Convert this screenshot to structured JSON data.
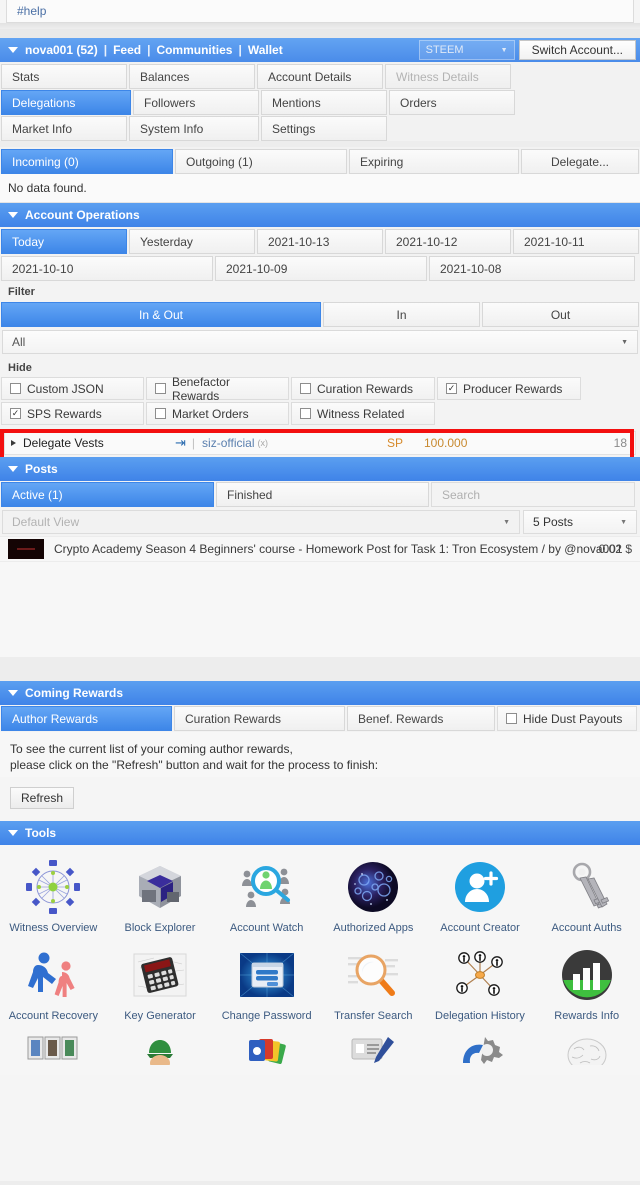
{
  "help_strip": {
    "tag": "#help"
  },
  "account_bar": {
    "username": "nova001 (52)",
    "links": [
      "Feed",
      "Communities",
      "Wallet"
    ],
    "coin": "STEEM",
    "switch_label": "Switch Account..."
  },
  "nav_tabs": [
    {
      "label": "Stats",
      "state": "normal"
    },
    {
      "label": "Balances",
      "state": "normal"
    },
    {
      "label": "Account Details",
      "state": "normal"
    },
    {
      "label": "Witness Details",
      "state": "disabled"
    },
    {
      "label": "Delegations",
      "state": "selected"
    },
    {
      "label": "Followers",
      "state": "normal"
    },
    {
      "label": "Mentions",
      "state": "normal"
    },
    {
      "label": "Orders",
      "state": "normal"
    },
    {
      "label": "Market Info",
      "state": "normal"
    },
    {
      "label": "System Info",
      "state": "normal"
    },
    {
      "label": "Settings",
      "state": "normal"
    }
  ],
  "delegations": {
    "tabs": [
      {
        "label": "Incoming (0)",
        "state": "selected"
      },
      {
        "label": "Outgoing (1)",
        "state": "normal"
      },
      {
        "label": "Expiring",
        "state": "normal"
      },
      {
        "label": "Delegate...",
        "state": "normal"
      }
    ],
    "empty_message": "No data found."
  },
  "account_operations": {
    "title": "Account Operations",
    "date_tabs": [
      {
        "label": "Today",
        "state": "selected"
      },
      {
        "label": "Yesterday",
        "state": "normal"
      },
      {
        "label": "2021-10-13",
        "state": "normal"
      },
      {
        "label": "2021-10-12",
        "state": "normal"
      },
      {
        "label": "2021-10-11",
        "state": "normal"
      },
      {
        "label": "2021-10-10",
        "state": "normal"
      },
      {
        "label": "2021-10-09",
        "state": "normal"
      },
      {
        "label": "2021-10-08",
        "state": "normal"
      }
    ],
    "filter_label": "Filter",
    "filter_tabs": [
      {
        "label": "In & Out",
        "state": "selected"
      },
      {
        "label": "In",
        "state": "normal"
      },
      {
        "label": "Out",
        "state": "normal"
      }
    ],
    "type_select": "All",
    "hide_label": "Hide",
    "hide_options": [
      {
        "label": "Custom JSON",
        "checked": false
      },
      {
        "label": "Benefactor Rewards",
        "checked": false
      },
      {
        "label": "Curation Rewards",
        "checked": false
      },
      {
        "label": "Producer Rewards",
        "checked": true
      },
      {
        "label": "SPS Rewards",
        "checked": true
      },
      {
        "label": "Market Orders",
        "checked": false
      },
      {
        "label": "Witness Related",
        "checked": false
      }
    ],
    "operation_row": {
      "name": "Delegate Vests",
      "direction_icon": "arrow-into-box-icon",
      "account": "siz-official",
      "reputation": "(x)",
      "currency": "SP",
      "amount": "100.000",
      "trailing": "18",
      "highlight_color": "#f30f0f"
    }
  },
  "posts": {
    "title": "Posts",
    "tabs": [
      {
        "label": "Active (1)",
        "state": "selected"
      },
      {
        "label": "Finished",
        "state": "normal"
      }
    ],
    "search_placeholder": "Search",
    "view_select": "Default View",
    "count_select": "5 Posts",
    "rows": [
      {
        "title": "Crypto Academy Season 4 Beginners' course - Homework Post for Task 1: Tron Ecosystem / by @nova001",
        "payout": "0.02 $"
      }
    ]
  },
  "coming_rewards": {
    "title": "Coming Rewards",
    "tabs": [
      {
        "label": "Author Rewards",
        "state": "selected"
      },
      {
        "label": "Curation Rewards",
        "state": "normal"
      },
      {
        "label": "Benef. Rewards",
        "state": "normal"
      }
    ],
    "hide_dust": {
      "label": "Hide Dust Payouts",
      "checked": false
    },
    "text_line1": "To see the current list of your coming author rewards,",
    "text_line2": "please click on the \"Refresh\" button and wait for the process to finish:",
    "refresh_label": "Refresh"
  },
  "tools": {
    "title": "Tools",
    "items": [
      {
        "label": "Witness Overview",
        "icon": "network-graph-icon"
      },
      {
        "label": "Block Explorer",
        "icon": "cube-icon"
      },
      {
        "label": "Account Watch",
        "icon": "magnifier-people-icon"
      },
      {
        "label": "Authorized Apps",
        "icon": "cosmic-circle-icon"
      },
      {
        "label": "Account Creator",
        "icon": "user-plus-icon"
      },
      {
        "label": "Account Auths",
        "icon": "keys-icon"
      },
      {
        "label": "Account Recovery",
        "icon": "helping-hands-icon"
      },
      {
        "label": "Key Generator",
        "icon": "calculator-icon"
      },
      {
        "label": "Change Password",
        "icon": "login-form-icon"
      },
      {
        "label": "Transfer Search",
        "icon": "magnifier-document-icon"
      },
      {
        "label": "Delegation History",
        "icon": "delegation-network-icon"
      },
      {
        "label": "Rewards Info",
        "icon": "bar-chart-circle-icon"
      }
    ],
    "partial_row": [
      {
        "icon": "photo-strip-icon"
      },
      {
        "icon": "elf-icon"
      },
      {
        "icon": "color-cards-icon"
      },
      {
        "icon": "form-pen-icon"
      },
      {
        "icon": "gear-wrench-icon"
      },
      {
        "icon": "brain-icon"
      }
    ]
  },
  "colors": {
    "accent_blue": "#3f83e8",
    "highlight_red": "#f30f0f",
    "amount_orange": "#c88a30",
    "link_blue": "#3c5a80"
  }
}
